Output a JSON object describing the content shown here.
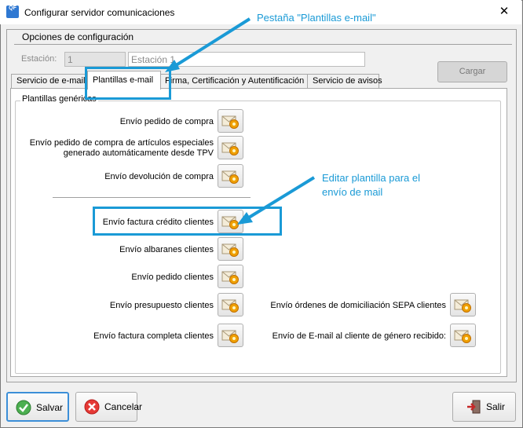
{
  "window": {
    "title": "Configurar servidor comunicaciones",
    "icon_text": "QF",
    "close_glyph": "✕"
  },
  "config_group": {
    "title": "Opciones de configuración"
  },
  "station": {
    "label": "Estación:",
    "id_value": "1",
    "name_value": "Estación 1"
  },
  "cargar_label": "Cargar",
  "tabs": [
    {
      "label": "Servicio de e-mail",
      "selected": false
    },
    {
      "label": "Plantillas e-mail",
      "selected": true
    },
    {
      "label": "Firma, Certificación y Autentificación",
      "selected": false
    },
    {
      "label": "Servicio de avisos",
      "selected": false
    }
  ],
  "generic_templates": {
    "title": "Plantillas genéricas",
    "items": [
      {
        "label": "Envío pedido de compra",
        "icon": "envelope-gear-icon"
      },
      {
        "label": "Envío pedido de compra de artículos especiales generado automáticamente desde TPV",
        "icon": "envelope-gear-icon"
      },
      {
        "label": "Envío devolución de compra",
        "icon": "envelope-gear-icon"
      }
    ]
  },
  "client_templates_left": [
    {
      "label": "Envío factura crédito clientes",
      "icon": "envelope-gear-icon"
    },
    {
      "label": "Envío albaranes clientes",
      "icon": "envelope-gear-icon"
    },
    {
      "label": "Envío pedido clientes",
      "icon": "envelope-gear-icon"
    },
    {
      "label": "Envío presupuesto clientes",
      "icon": "envelope-gear-icon"
    },
    {
      "label": "Envío factura completa clientes",
      "icon": "envelope-gear-icon"
    }
  ],
  "client_templates_right": [
    {
      "label": "Envío órdenes de domiciliación SEPA clientes",
      "icon": "envelope-gear-icon"
    },
    {
      "label": "Envío de E-mail al cliente de género recibido:",
      "icon": "envelope-gear-icon"
    }
  ],
  "annotations": {
    "tab_note": "Pestaña \"Plantillas e-mail\"",
    "edit_note_line1": "Editar plantilla para el",
    "edit_note_line2": "envío de mail",
    "color": "#1a9ad6"
  },
  "footer": {
    "save_label": "Salvar",
    "cancel_label": "Cancelar",
    "exit_label": "Salir"
  }
}
